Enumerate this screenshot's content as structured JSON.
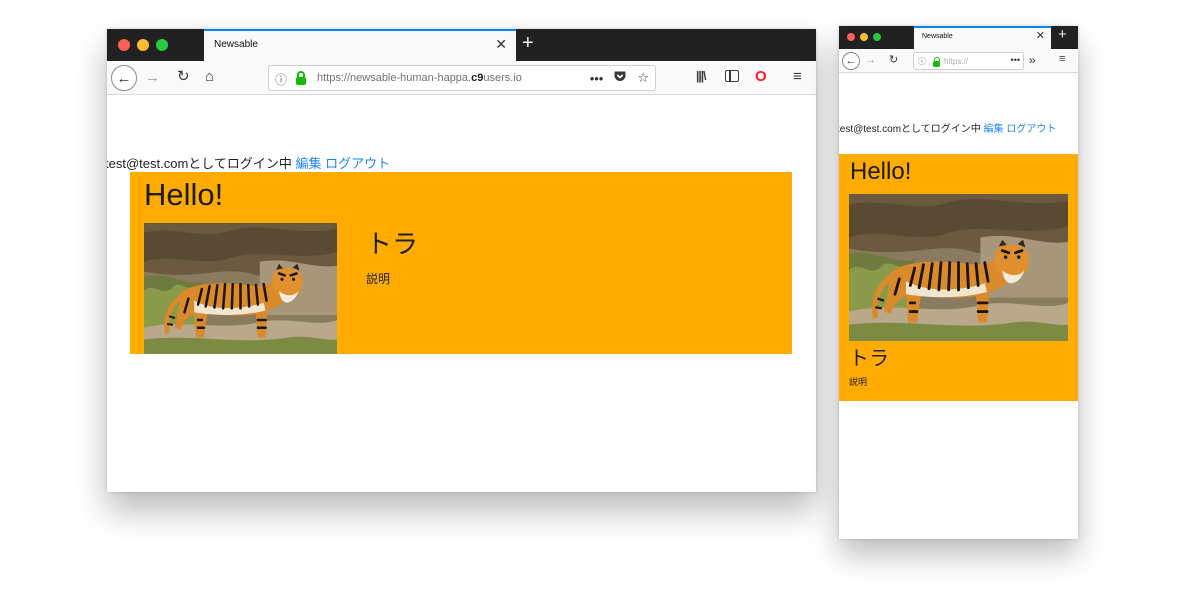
{
  "desktop": {
    "tab_title": "Newsable",
    "url_prefix": "https://newsable-human-happa.",
    "url_bold": "c9",
    "url_rest": "users.io"
  },
  "mobile": {
    "tab_title": "Newsable",
    "url_prefix": "https://",
    "url_bold": "",
    "url_rest": ""
  },
  "page": {
    "login_text": "test@test.comとしてログイン中",
    "edit_link": "編集",
    "logout_link": "ログアウト",
    "heading": "Hello!",
    "item": {
      "title": "トラ",
      "description": "説明",
      "image_subject": "tiger"
    }
  },
  "icons": {
    "back": "back-arrow-icon",
    "forward": "forward-arrow-icon",
    "reload": "reload-icon",
    "home": "home-icon",
    "site_info": "info-icon",
    "secure": "lock-icon",
    "page_actions": "more-icon",
    "pocket": "pocket-icon",
    "bookmark": "star-icon",
    "library": "library-icon",
    "sidebar": "sidebar-icon",
    "opera": "opera-icon",
    "menu": "hamburger-menu-icon",
    "overflow": "overflow-chevron-icon"
  },
  "colors": {
    "panel": "#ffab00",
    "link": "#1e87f0",
    "tab_accent": "#0a84ff",
    "titlebar": "#212121"
  }
}
